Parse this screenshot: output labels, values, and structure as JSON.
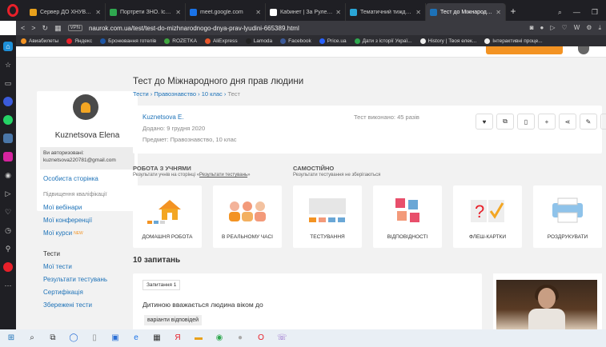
{
  "browser": {
    "tabs": [
      {
        "title": "Сервер ДО ХНУВС (нав",
        "color": "#e8a11c"
      },
      {
        "title": "Портрети ЗНО. Історія ",
        "color": "#2fa84f"
      },
      {
        "title": "meet.google.com",
        "color": "#1a73e8"
      },
      {
        "title": "Кабинет | За Рулем | Я",
        "color": "#ffffff"
      },
      {
        "title": "Тематичний тиждень п",
        "color": "#2aa6d6"
      },
      {
        "title": "Тест до Міжнародного",
        "color": "#1d72b8"
      }
    ],
    "url": "naurok.com.ua/test/test-do-mizhnarodnogo-dnya-prav-lyudini-665389.html",
    "vpn": "VPN",
    "bookmarks": [
      {
        "label": "Авиабилеты",
        "color": "#f39323"
      },
      {
        "label": "Яндекс",
        "color": "#e8202a"
      },
      {
        "label": "Бронювання готелів",
        "color": "#1d56a5"
      },
      {
        "label": "ROZETKA",
        "color": "#3fa63f"
      },
      {
        "label": "AliExpress",
        "color": "#e8562a"
      },
      {
        "label": "Lamoda",
        "color": "#222222"
      },
      {
        "label": "Facebook",
        "color": "#3b5998"
      },
      {
        "label": "Price.ua",
        "color": "#2962ff"
      },
      {
        "label": "Дати з історії Украї...",
        "color": "#2fa84f"
      },
      {
        "label": "History | Твоя елек...",
        "color": "#eeeeee"
      },
      {
        "label": "Інтерактивні проце...",
        "color": "#eeeeee"
      }
    ]
  },
  "profile": {
    "name": "Kuznetsova Elena",
    "auth_line1": "Ви авторизовані:",
    "auth_line2": "kuznetsova220781@gmail.com",
    "personal": "Особиста сторінка"
  },
  "menu": {
    "sec1": "Підвищення кваліфікації",
    "webinars": "Мої вебінари",
    "conferences": "Мої конференції",
    "courses": "Мої курси",
    "new_badge": "NEW",
    "tests_sec": "Тести",
    "my_tests": "Мої тести",
    "results": "Результати тестувань",
    "certs": "Сертифікація",
    "saved": "Збережені тести"
  },
  "page": {
    "title": "Тест до Міжнародного дня прав людини",
    "breadcrumbs": [
      "Тести",
      "Правознавство",
      "10 клас",
      "Тест"
    ],
    "author": "Kuznetsova E.",
    "added": "Додано: 9 грудня 2020",
    "subject": "Предмет: Правознавство, 10 клас",
    "done": "Тест виконано: 45 разів"
  },
  "groups": {
    "with_students": "РОБОТА З УЧНЯМИ",
    "with_students_sub_pre": "Результати учнів на сторінці «",
    "with_students_sub_link": "Результати тестувань",
    "with_students_sub_post": "»",
    "self": "САМОСТІЙНО",
    "self_sub": "Результати тестування не зберігаються"
  },
  "modes": [
    {
      "label": "ДОМАШНЯ РОБОТА"
    },
    {
      "label": "В РЕАЛЬНОМУ ЧАСІ"
    },
    {
      "label": "ТЕСТУВАННЯ"
    },
    {
      "label": "ВІДПОВІДНОСТІ"
    },
    {
      "label": "ФЛЕШ-КАРТКИ"
    },
    {
      "label": "РОЗДРУКУВАТИ"
    }
  ],
  "questions": {
    "heading": "10 запитань",
    "tag": "Запитання 1",
    "text": "Дитиною вважається людина віком до",
    "variants": "варіанти відповідей"
  }
}
